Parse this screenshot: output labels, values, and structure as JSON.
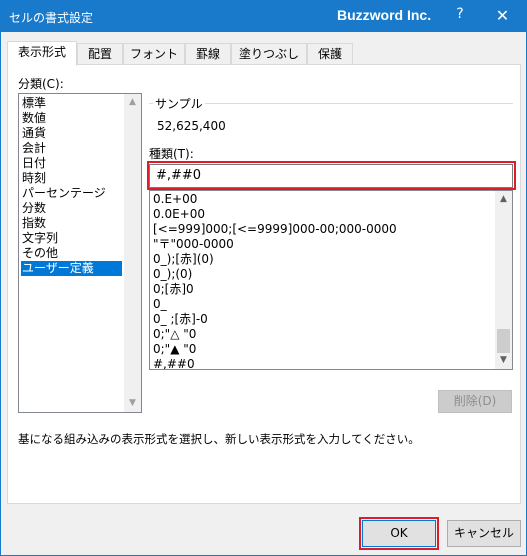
{
  "window": {
    "title": "セルの書式設定",
    "brand": "Buzzword Inc.",
    "help_label": "?",
    "close_label": "✕"
  },
  "tabs": [
    {
      "label": "表示形式",
      "active": true
    },
    {
      "label": "配置"
    },
    {
      "label": "フォント"
    },
    {
      "label": "罫線"
    },
    {
      "label": "塗りつぶし"
    },
    {
      "label": "保護"
    }
  ],
  "category": {
    "label": "分類(C):",
    "items": [
      "標準",
      "数値",
      "通貨",
      "会計",
      "日付",
      "時刻",
      "パーセンテージ",
      "分数",
      "指数",
      "文字列",
      "その他",
      "ユーザー定義"
    ],
    "selected": "ユーザー定義"
  },
  "sample": {
    "label": "サンプル",
    "value": "52,625,400"
  },
  "type": {
    "label": "種類(T):",
    "value": "#,##0"
  },
  "format_list": [
    "0.E+00",
    "0.0E+00",
    "[<=999]000;[<=9999]000-00;000-0000",
    "\"〒\"000-0000",
    "0_);[赤](0)",
    "0_);(0)",
    "0;[赤]0",
    "0_",
    "0_ ;[赤]-0",
    "0;\"△ \"0",
    "0;\"▲ \"0",
    "#,##0_"
  ],
  "buttons": {
    "delete": "削除(D)",
    "ok": "OK",
    "cancel": "キャンセル"
  },
  "description": "基になる組み込みの表示形式を選択し、新しい表示形式を入力してください。",
  "colors": {
    "titlebar": "#1979ca",
    "selection": "#0078d7",
    "highlight": "#d9202a"
  }
}
